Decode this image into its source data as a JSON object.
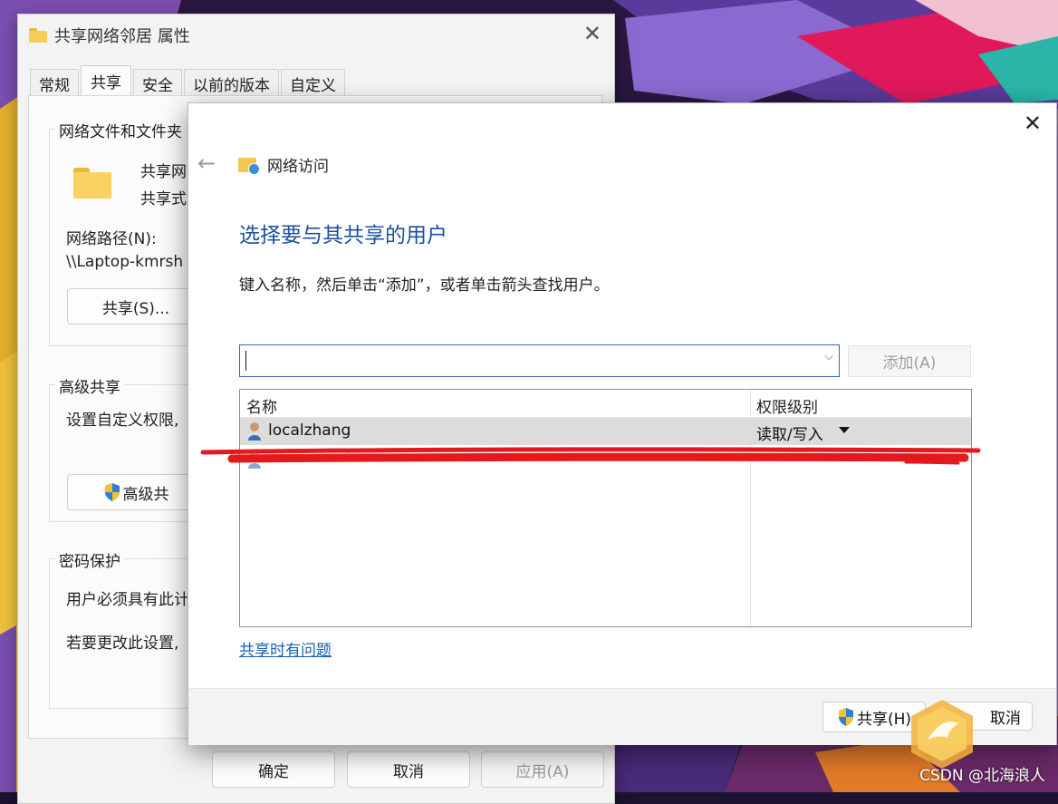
{
  "props_window": {
    "title": "共享网络邻居 属性",
    "tabs": [
      "常规",
      "共享",
      "安全",
      "以前的版本",
      "自定义"
    ],
    "sharing_group_label": "网络文件和文件夹",
    "folder_name": "共享网",
    "folder_status": "共享式",
    "network_path_label": "网络路径(N):",
    "network_path_value": "\\\\Laptop-kmrsh",
    "share_button": "共享(S)...",
    "advanced_group_label": "高级共享",
    "advanced_text": "设置自定义权限,",
    "advanced_button": "高级共",
    "password_group_label": "密码保护",
    "password_text_1": "用户必须具有此计",
    "password_text_2": "若要更改此设置,",
    "ok_button": "确定",
    "cancel_button": "取消",
    "apply_button": "应用(A)"
  },
  "net_window": {
    "title": "网络访问",
    "heading": "选择要与其共享的用户",
    "instruction": "键入名称，然后单击“添加”，或者单击箭头查找用户。",
    "input_value": "",
    "add_button": "添加(A)",
    "columns": {
      "name": "名称",
      "permission": "权限级别"
    },
    "rows": [
      {
        "name": "localzhang",
        "permission": "读取/写入"
      }
    ],
    "help_link": "共享时有问题",
    "share_button": "共享(H)",
    "cancel_button": "取消"
  },
  "watermark": "CSDN @北海浪人",
  "colors": {
    "heading": "#1d4fa0",
    "link": "#1a5fb4",
    "annotation": "#e3191d",
    "selected_row": "#dcdcdc"
  }
}
